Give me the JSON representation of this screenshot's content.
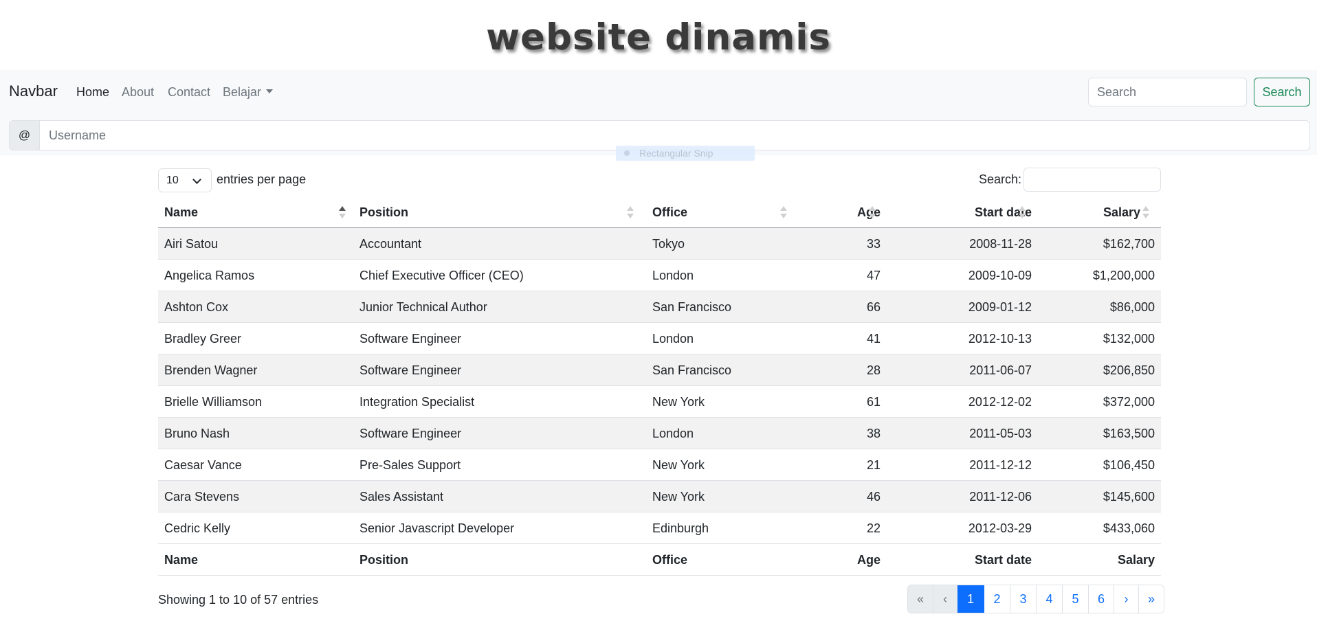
{
  "site": {
    "title": "website dinamis"
  },
  "navbar": {
    "brand": "Navbar",
    "links": [
      {
        "label": "Home"
      },
      {
        "label": "About"
      },
      {
        "label": "Contact"
      },
      {
        "label": "Belajar"
      }
    ],
    "search_placeholder": "Search",
    "search_button": "Search"
  },
  "username_group": {
    "prefix": "@",
    "placeholder": "Username"
  },
  "snip_overlay": {
    "label": "Rectangular Snip"
  },
  "table_controls": {
    "per_page_value": "10",
    "per_page_label": "entries per page",
    "search_label": "Search:"
  },
  "table": {
    "columns": [
      "Name",
      "Position",
      "Office",
      "Age",
      "Start date",
      "Salary"
    ],
    "rows": [
      [
        "Airi Satou",
        "Accountant",
        "Tokyo",
        "33",
        "2008-11-28",
        "$162,700"
      ],
      [
        "Angelica Ramos",
        "Chief Executive Officer (CEO)",
        "London",
        "47",
        "2009-10-09",
        "$1,200,000"
      ],
      [
        "Ashton Cox",
        "Junior Technical Author",
        "San Francisco",
        "66",
        "2009-01-12",
        "$86,000"
      ],
      [
        "Bradley Greer",
        "Software Engineer",
        "London",
        "41",
        "2012-10-13",
        "$132,000"
      ],
      [
        "Brenden Wagner",
        "Software Engineer",
        "San Francisco",
        "28",
        "2011-06-07",
        "$206,850"
      ],
      [
        "Brielle Williamson",
        "Integration Specialist",
        "New York",
        "61",
        "2012-12-02",
        "$372,000"
      ],
      [
        "Bruno Nash",
        "Software Engineer",
        "London",
        "38",
        "2011-05-03",
        "$163,500"
      ],
      [
        "Caesar Vance",
        "Pre-Sales Support",
        "New York",
        "21",
        "2011-12-12",
        "$106,450"
      ],
      [
        "Cara Stevens",
        "Sales Assistant",
        "New York",
        "46",
        "2011-12-06",
        "$145,600"
      ],
      [
        "Cedric Kelly",
        "Senior Javascript Developer",
        "Edinburgh",
        "22",
        "2012-03-29",
        "$433,060"
      ]
    ]
  },
  "footer": {
    "info": "Showing 1 to 10 of 57 entries",
    "pages": [
      "«",
      "‹",
      "1",
      "2",
      "3",
      "4",
      "5",
      "6",
      "›",
      "»"
    ]
  }
}
